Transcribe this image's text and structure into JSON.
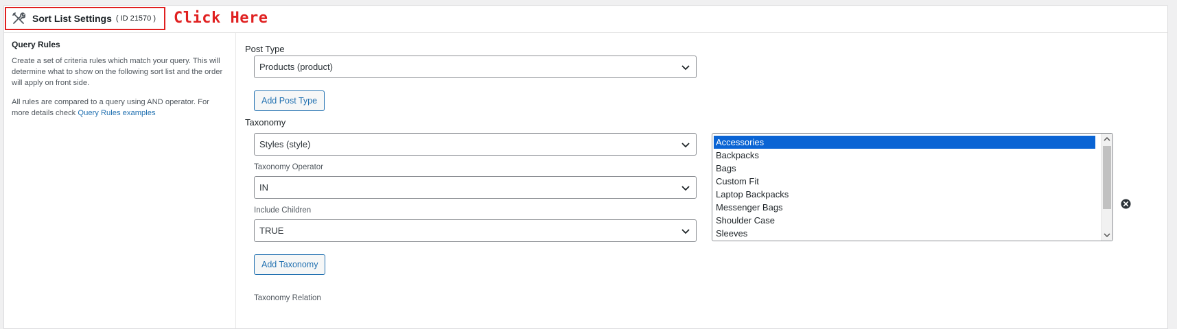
{
  "header": {
    "title": "Sort List Settings",
    "id_label": "( ID 21570 )",
    "tools_icon": "tools-icon"
  },
  "annotation": {
    "text": "Click Here",
    "color": "#e02020"
  },
  "sidebar": {
    "heading": "Query Rules",
    "description": "Create a set of criteria rules which match your query. This will determine what to show on the following sort list and the order will apply on front side.",
    "note_prefix": "All rules are compared to a query using AND operator. For more details check ",
    "note_link": "Query Rules examples"
  },
  "post_type": {
    "label": "Post Type",
    "selected": "Products (product)",
    "add_button": "Add Post Type"
  },
  "taxonomy": {
    "label": "Taxonomy",
    "selected": "Styles (style)",
    "operator_label": "Taxonomy Operator",
    "operator_value": "IN",
    "children_label": "Include Children",
    "children_value": "TRUE",
    "terms": [
      "Accessories",
      "Backpacks",
      "Bags",
      "Custom Fit",
      "Laptop Backpacks",
      "Messenger Bags",
      "Shoulder Case",
      "Sleeves"
    ],
    "selected_term": "Accessories",
    "add_button": "Add Taxonomy",
    "relation_label": "Taxonomy Relation",
    "remove_icon": "remove-circle-icon"
  },
  "colors": {
    "accent": "#2271b1",
    "selection": "#0a64d4",
    "highlight_border": "#e02020"
  }
}
